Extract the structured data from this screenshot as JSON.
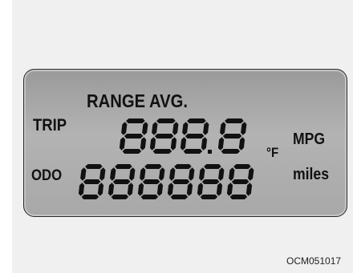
{
  "display": {
    "range_avg_label": "RANGE AVG.",
    "trip_label": "TRIP",
    "odo_label": "ODO",
    "temp_unit": "°F",
    "mpg_unit": "MPG",
    "miles_unit": "miles",
    "upper_readout": "888.8",
    "lower_readout": "888888"
  },
  "figure_code": "OCM051017",
  "colors": {
    "lcd_background": "#a8a8a8",
    "segment": "#111111",
    "page_background": "#f0f0f0"
  }
}
